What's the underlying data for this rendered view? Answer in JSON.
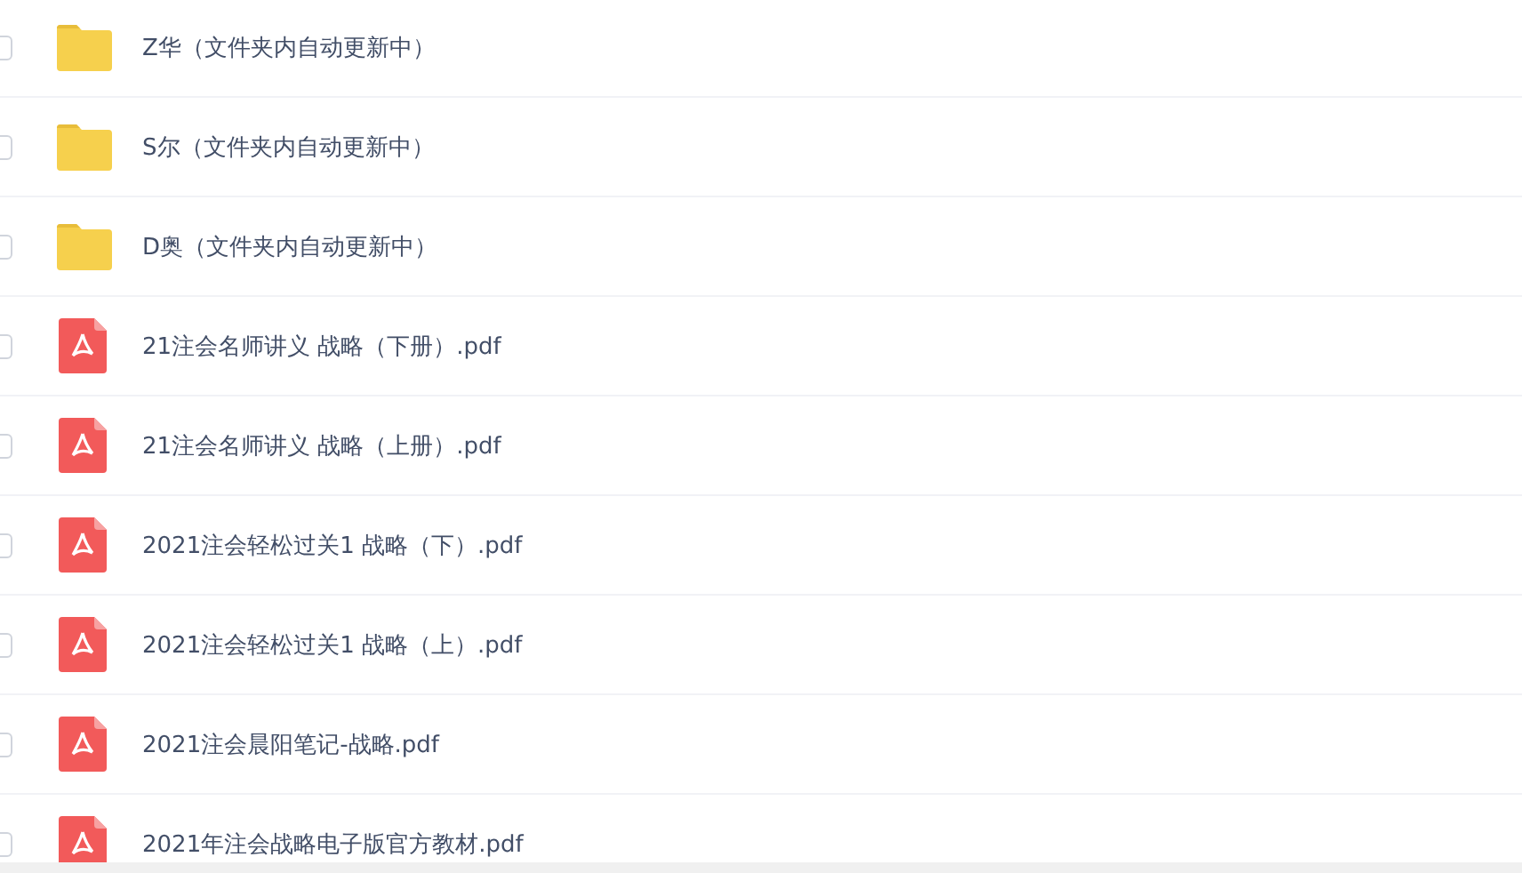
{
  "files": [
    {
      "kind": "folder",
      "name": "Z华（文件夹内自动更新中）",
      "checked": false
    },
    {
      "kind": "folder",
      "name": "S尔（文件夹内自动更新中）",
      "checked": false
    },
    {
      "kind": "folder",
      "name": "D奥（文件夹内自动更新中）",
      "checked": false
    },
    {
      "kind": "pdf",
      "name": "21注会名师讲义 战略（下册）.pdf",
      "checked": false
    },
    {
      "kind": "pdf",
      "name": "21注会名师讲义 战略（上册）.pdf",
      "checked": false
    },
    {
      "kind": "pdf",
      "name": "2021注会轻松过关1 战略（下）.pdf",
      "checked": false
    },
    {
      "kind": "pdf",
      "name": "2021注会轻松过关1 战略（上）.pdf",
      "checked": false
    },
    {
      "kind": "pdf",
      "name": "2021注会晨阳笔记-战略.pdf",
      "checked": false
    },
    {
      "kind": "pdf",
      "name": "2021年注会战略电子版官方教材.pdf",
      "checked": false
    }
  ]
}
